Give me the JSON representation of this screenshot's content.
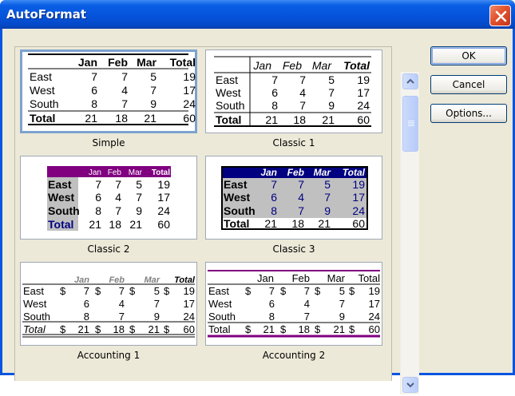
{
  "window": {
    "title": "AutoFormat"
  },
  "buttons": {
    "ok": "OK",
    "cancel": "Cancel",
    "options": "Options..."
  },
  "months": [
    "Jan",
    "Feb",
    "Mar"
  ],
  "total_label": "Total",
  "regions": [
    "East",
    "West",
    "South"
  ],
  "values": [
    [
      7,
      7,
      5,
      19
    ],
    [
      6,
      4,
      7,
      17
    ],
    [
      8,
      7,
      9,
      24
    ]
  ],
  "totals": [
    21,
    18,
    21,
    60
  ],
  "currency": "$",
  "formats": [
    {
      "name": "Simple",
      "selected": true
    },
    {
      "name": "Classic 1",
      "selected": false
    },
    {
      "name": "Classic 2",
      "selected": false
    },
    {
      "name": "Classic 3",
      "selected": false
    },
    {
      "name": "Accounting 1",
      "selected": false
    },
    {
      "name": "Accounting 2",
      "selected": false
    }
  ],
  "colors": {
    "classic2_header": "#800080",
    "classic2_rows": "#c0c0c0",
    "classic2_total": "#000080",
    "classic3_header": "#000080",
    "classic3_rows": "#c0c0c0",
    "classic3_values": "#000080",
    "accounting_header": "#808080",
    "accounting2_rule": "#800080",
    "selection": "#7da2ce"
  }
}
